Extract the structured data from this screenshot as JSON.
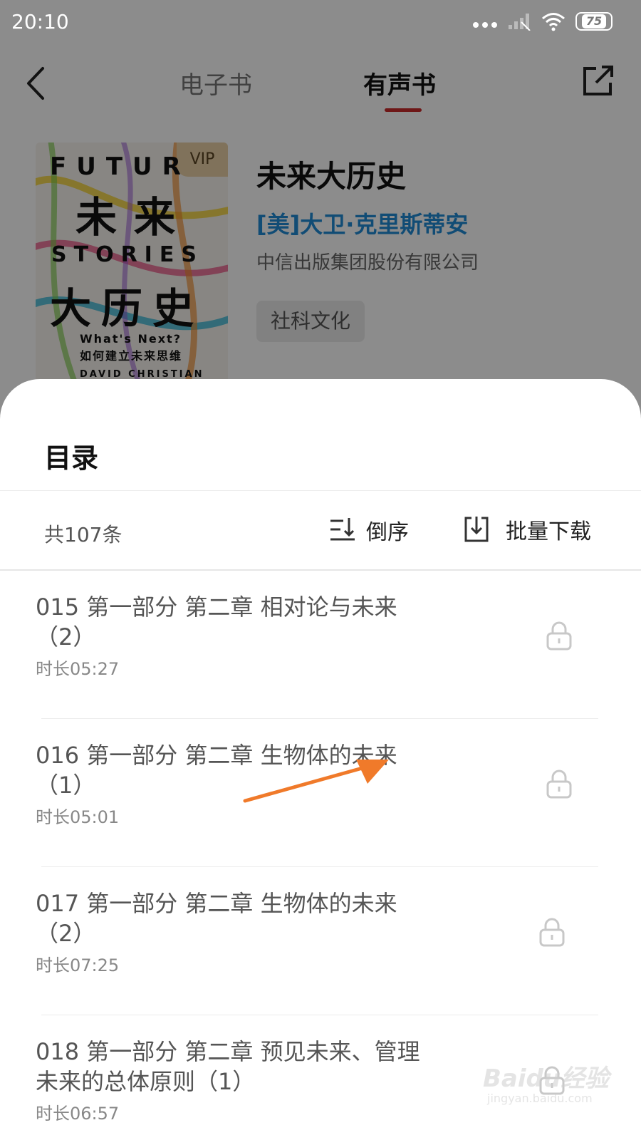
{
  "status_bar": {
    "time": "20:10",
    "battery": "75"
  },
  "nav": {
    "tab_ebook": "电子书",
    "tab_audiobook": "有声书"
  },
  "book": {
    "title": "未来大历史",
    "author": "[美]大卫·克里斯蒂安",
    "publisher": "中信出版集团股份有限公司",
    "tag": "社科文化",
    "cover": {
      "vip": "VIP",
      "line1": "FUTUR",
      "cn1": "未来",
      "line2": "STORIES",
      "cn2": "大历史",
      "sub1": "What's Next?",
      "sub2": "如何建立未来思维",
      "author": "DAVID CHRISTIAN"
    }
  },
  "sheet": {
    "title": "目录",
    "count": "共107条",
    "sort_label": "倒序",
    "download_label": "批量下载"
  },
  "episodes": [
    {
      "title": "015 第一部分 第二章 相对论与未来（2）",
      "duration": "时长05:27",
      "locked": true
    },
    {
      "title": "016 第一部分 第二章 生物体的未来（1）",
      "duration": "时长05:01",
      "locked": true
    },
    {
      "title": "017 第一部分 第二章 生物体的未来（2）",
      "duration": "时长07:25",
      "locked": true
    },
    {
      "title": "018 第一部分 第二章 预见未来、管理未来的总体原则（1）",
      "duration": "时长06:57",
      "locked": true
    }
  ],
  "annotation": {
    "color": "#f07a2a"
  },
  "watermark": {
    "brand": "Baidu经验",
    "url": "jingyan.baidu.com"
  },
  "colors": {
    "accent": "#c92a2a",
    "author_link": "#1f8bd6"
  }
}
